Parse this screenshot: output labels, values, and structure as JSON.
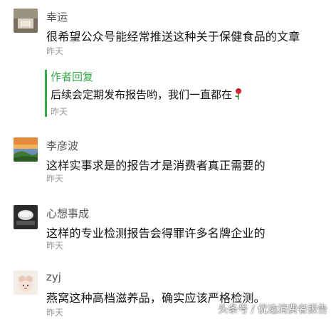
{
  "comments": [
    {
      "name": "幸运",
      "text": "很希望公众号能经常推送这种关于保健食品的文章",
      "time": "昨天"
    },
    {
      "name": "李彦波",
      "text": "这样实事求是的报告才是消费者真正需要的",
      "time": "昨天"
    },
    {
      "name": "心想事成",
      "text": "这样的专业检测报告会得罪许多名牌企业的",
      "time": "昨天"
    },
    {
      "name": "zyj",
      "text": "燕窝这种高档滋养品，确实应该严格检测。",
      "time": "昨天"
    }
  ],
  "author_reply": {
    "title": "作者回复",
    "text": "后续会定期发布报告哟，我们一直都在",
    "time": "昨天",
    "emoji": "rose-icon"
  },
  "watermark": "头条号 / 优选消费者报告",
  "colors": {
    "accent": "#35a84a",
    "muted": "#9a9a9a"
  }
}
